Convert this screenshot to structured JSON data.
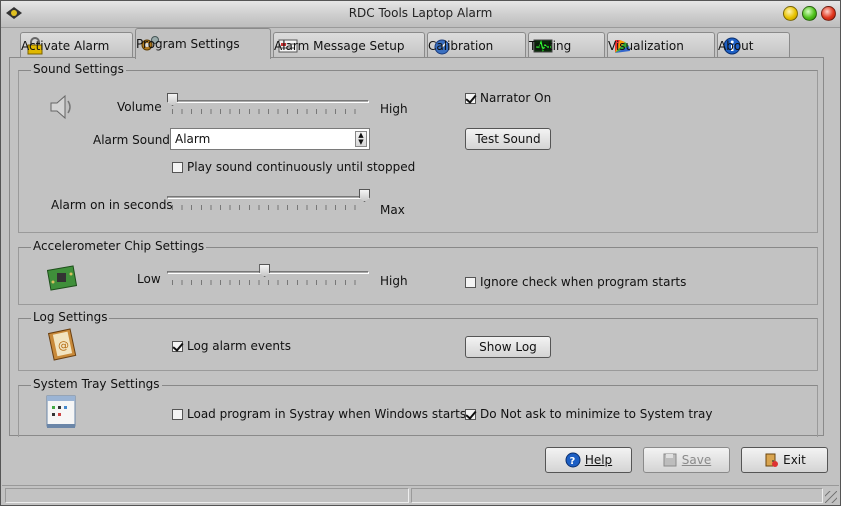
{
  "window": {
    "title": "RDC Tools Laptop Alarm"
  },
  "tabs": [
    {
      "label": "Activate Alarm",
      "icon": "padlock-icon"
    },
    {
      "label": "Program Settings",
      "icon": "gears-icon",
      "active": true
    },
    {
      "label": "Alarm Message Setup",
      "icon": "message-card-icon"
    },
    {
      "label": "Calibration",
      "icon": "gauge-icon"
    },
    {
      "label": "Testing",
      "icon": "oscilloscope-icon"
    },
    {
      "label": "Visualization",
      "icon": "color-fan-icon"
    },
    {
      "label": "About",
      "icon": "info-icon"
    }
  ],
  "sound": {
    "group_title": "Sound Settings",
    "volume_label": "Volume",
    "volume_high": "High",
    "volume_value": 0,
    "alarm_sound_label": "Alarm Sound",
    "alarm_sound_value": "Alarm",
    "play_continuous_label": "Play sound continuously until stopped",
    "play_continuous_checked": false,
    "alarm_on_label": "Alarm on in seconds",
    "alarm_on_max": "Max",
    "alarm_on_value": 1,
    "narrator_label": "Narrator On",
    "narrator_checked": true,
    "test_sound_label": "Test Sound"
  },
  "accelerometer": {
    "group_title": "Accelerometer Chip Settings",
    "low_label": "Low",
    "high_label": "High",
    "sensitivity_value": 0.48,
    "ignore_check_label": "Ignore check when program starts",
    "ignore_check_checked": false
  },
  "log": {
    "group_title": "Log Settings",
    "log_events_label": "Log alarm events",
    "log_events_checked": true,
    "show_log_label": "Show Log"
  },
  "tray": {
    "group_title": "System Tray Settings",
    "load_systray_label": "Load program in Systray when Windows starts",
    "load_systray_checked": false,
    "no_ask_minimize_label": "Do Not ask to minimize to System tray",
    "no_ask_minimize_checked": true
  },
  "footer": {
    "help_label": "Help",
    "save_label": "Save",
    "exit_label": "Exit"
  },
  "colors": {
    "window_bg": "#c2c2c2",
    "title_bar": "#d6d6d6"
  }
}
